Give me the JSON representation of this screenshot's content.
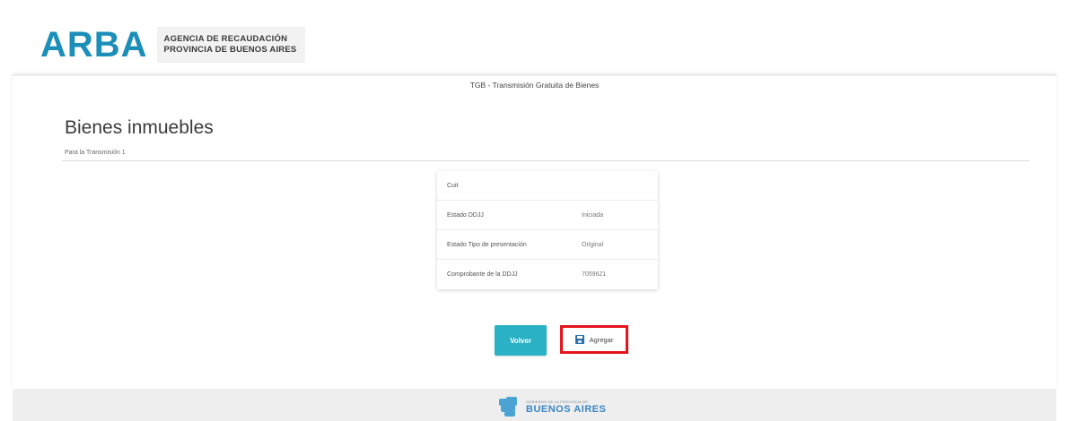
{
  "header": {
    "logo_text": "ARBA",
    "logo_subtitle_line1": "AGENCIA DE RECAUDACIÓN",
    "logo_subtitle_line2": "PROVINCIA DE BUENOS AIRES"
  },
  "app_title": "TGB - Transmisión Gratuita de Bienes",
  "page": {
    "title": "Bienes inmuebles",
    "subtitle": "Para la Transmisión 1"
  },
  "info_card": {
    "rows": [
      {
        "label": "Cuit",
        "value": ""
      },
      {
        "label": "Estado DDJJ",
        "value": "Iniciada"
      },
      {
        "label": "Estado Tipo de presentación",
        "value": "Original"
      },
      {
        "label": "Comprobante de la DDJJ",
        "value": "7059621"
      }
    ]
  },
  "actions": {
    "volver_label": "Volver",
    "agregar_label": "Agregar",
    "agregar_icon": "save-icon",
    "highlight_color": "#e3141b",
    "primary_color": "#2bb1c6"
  },
  "footer": {
    "small_text": "GOBIERNO DE LA PROVINCIA DE",
    "big_text": "BUENOS AIRES"
  }
}
